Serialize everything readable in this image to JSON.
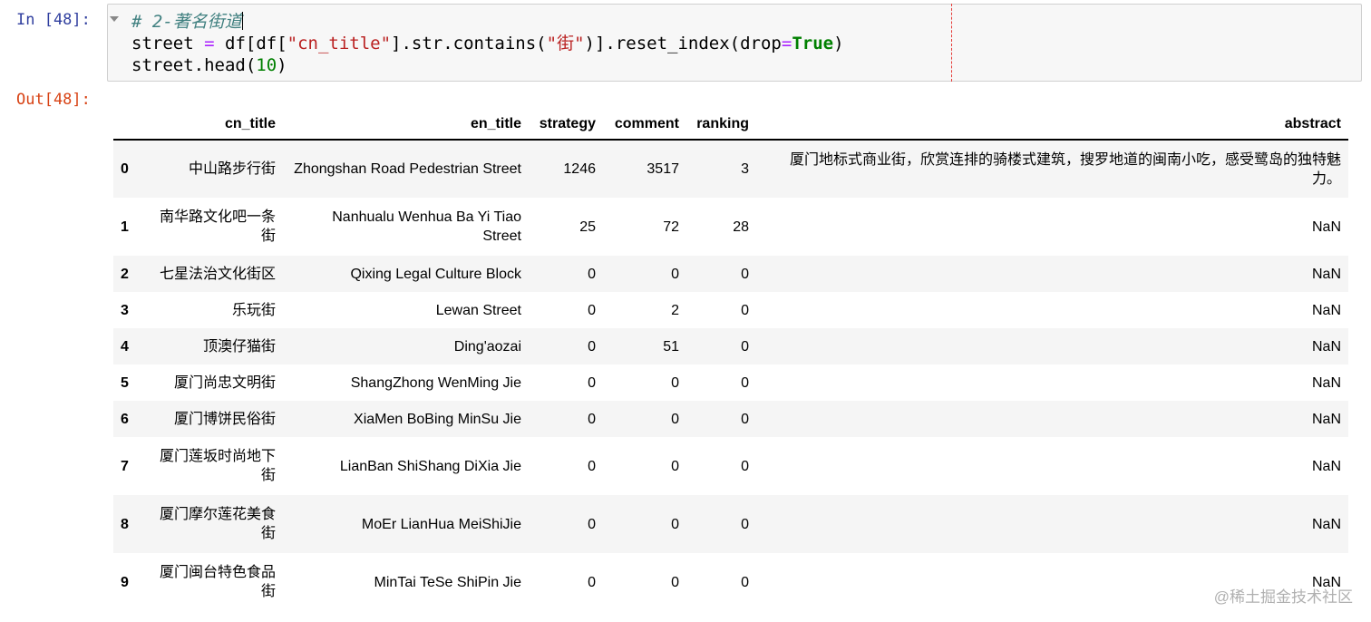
{
  "input_prompt": "In [48]:",
  "output_prompt": "Out[48]:",
  "code": {
    "line1_comment": "# 2-著名街道",
    "line2": {
      "a": "street",
      "op_eq": "=",
      "b": "df[df[",
      "str1": "\"cn_title\"",
      "c": "].str.contains(",
      "str2": "\"街\"",
      "d": ")].reset_index(drop",
      "op_eq2": "=",
      "kw": "True",
      "e": ")"
    },
    "line3": {
      "a": "street.head(",
      "num": "10",
      "b": ")"
    }
  },
  "table": {
    "columns": [
      "",
      "cn_title",
      "en_title",
      "strategy",
      "comment",
      "ranking",
      "abstract"
    ],
    "rows": [
      {
        "index": "0",
        "cn_title": "中山路步行街",
        "en_title": "Zhongshan Road Pedestrian Street",
        "strategy": "1246",
        "comment": "3517",
        "ranking": "3",
        "abstract": "厦门地标式商业街，欣赏连排的骑楼式建筑，搜罗地道的闽南小吃，感受鹭岛的独特魅力。"
      },
      {
        "index": "1",
        "cn_title": "南华路文化吧一条街",
        "en_title": "Nanhualu Wenhua Ba Yi Tiao Street",
        "strategy": "25",
        "comment": "72",
        "ranking": "28",
        "abstract": "NaN"
      },
      {
        "index": "2",
        "cn_title": "七星法治文化街区",
        "en_title": "Qixing Legal Culture Block",
        "strategy": "0",
        "comment": "0",
        "ranking": "0",
        "abstract": "NaN"
      },
      {
        "index": "3",
        "cn_title": "乐玩街",
        "en_title": "Lewan Street",
        "strategy": "0",
        "comment": "2",
        "ranking": "0",
        "abstract": "NaN"
      },
      {
        "index": "4",
        "cn_title": "顶澳仔猫街",
        "en_title": "Ding'aozai",
        "strategy": "0",
        "comment": "51",
        "ranking": "0",
        "abstract": "NaN"
      },
      {
        "index": "5",
        "cn_title": "厦门尚忠文明街",
        "en_title": "ShangZhong WenMing Jie",
        "strategy": "0",
        "comment": "0",
        "ranking": "0",
        "abstract": "NaN"
      },
      {
        "index": "6",
        "cn_title": "厦门博饼民俗街",
        "en_title": "XiaMen BoBing MinSu Jie",
        "strategy": "0",
        "comment": "0",
        "ranking": "0",
        "abstract": "NaN"
      },
      {
        "index": "7",
        "cn_title": "厦门莲坂时尚地下街",
        "en_title": "LianBan ShiShang DiXia Jie",
        "strategy": "0",
        "comment": "0",
        "ranking": "0",
        "abstract": "NaN"
      },
      {
        "index": "8",
        "cn_title": "厦门摩尔莲花美食街",
        "en_title": "MoEr LianHua MeiShiJie",
        "strategy": "0",
        "comment": "0",
        "ranking": "0",
        "abstract": "NaN"
      },
      {
        "index": "9",
        "cn_title": "厦门闽台特色食品街",
        "en_title": "MinTai TeSe ShiPin Jie",
        "strategy": "0",
        "comment": "0",
        "ranking": "0",
        "abstract": "NaN"
      }
    ]
  },
  "watermark": "@稀土掘金技术社区"
}
